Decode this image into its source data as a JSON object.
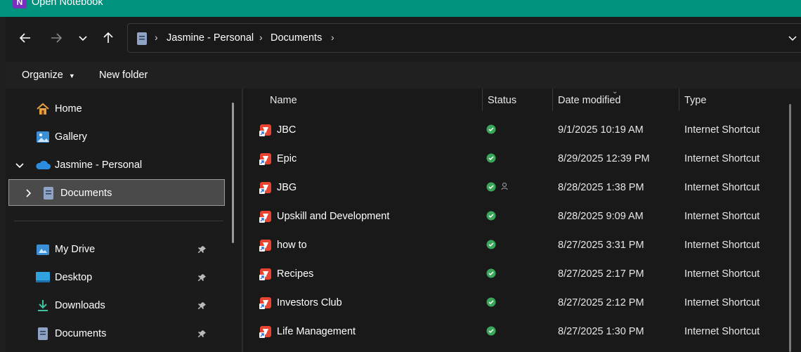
{
  "window": {
    "title": "Open Notebook",
    "app_icon": "onenote-icon",
    "app_letter": "N"
  },
  "address": {
    "crumbs": [
      "Jasmine - Personal",
      "Documents"
    ]
  },
  "toolbar": {
    "organize_label": "Organize",
    "new_folder_label": "New folder"
  },
  "nav": {
    "home": "Home",
    "gallery": "Gallery",
    "personal": "Jasmine - Personal",
    "documents": "Documents",
    "pinned": [
      "My Drive",
      "Desktop",
      "Downloads",
      "Documents"
    ]
  },
  "columns": {
    "name": "Name",
    "status": "Status",
    "date": "Date modified",
    "type": "Type"
  },
  "files": [
    {
      "name": "JBC",
      "date": "9/1/2025 10:19 AM",
      "type": "Internet Shortcut"
    },
    {
      "name": "Epic",
      "date": "8/29/2025 12:39 PM",
      "type": "Internet Shortcut"
    },
    {
      "name": "JBG",
      "date": "8/28/2025 1:38 PM",
      "type": "Internet Shortcut"
    },
    {
      "name": "Upskill and Development",
      "date": "8/28/2025 9:09 AM",
      "type": "Internet Shortcut"
    },
    {
      "name": "how to",
      "date": "8/27/2025 3:31 PM",
      "type": "Internet Shortcut"
    },
    {
      "name": "Recipes",
      "date": "8/27/2025 2:17 PM",
      "type": "Internet Shortcut"
    },
    {
      "name": "Investors Club",
      "date": "8/27/2025 2:12 PM",
      "type": "Internet Shortcut"
    },
    {
      "name": "Life Management",
      "date": "8/27/2025 1:30 PM",
      "type": "Internet Shortcut"
    }
  ],
  "colors": {
    "titlebar": "#00927c",
    "selection": "#4a4a4a",
    "status_ok": "#3aa65a"
  }
}
